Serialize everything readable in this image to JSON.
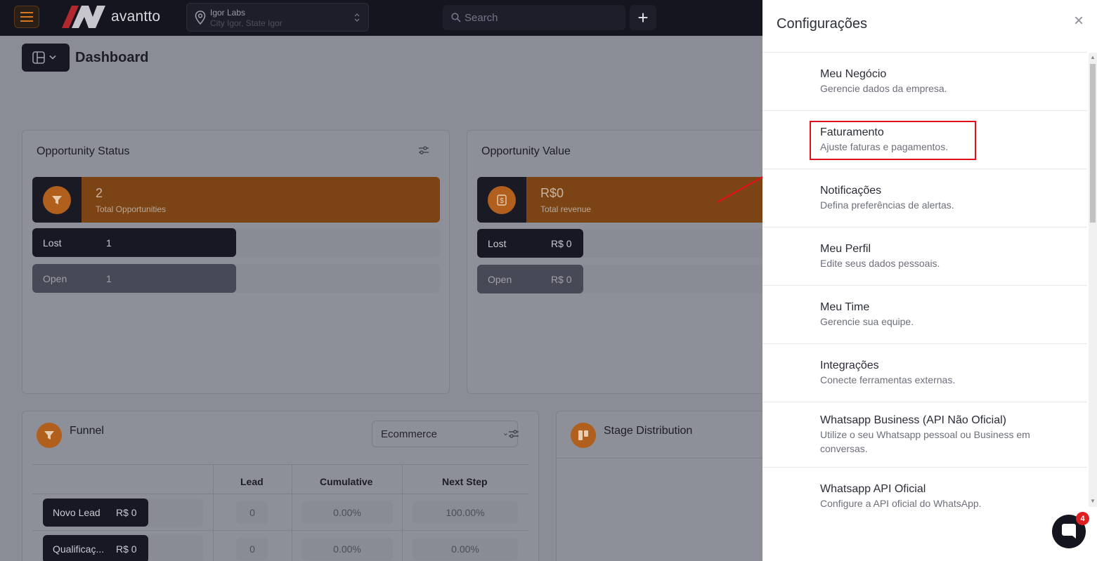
{
  "topbar": {
    "brand": "avantto",
    "location_name": "Igor Labs",
    "location_sub": "City Igor, State Igor",
    "search_placeholder": "Search",
    "add_label": "+"
  },
  "page": {
    "title": "Dashboard"
  },
  "opportunity_status": {
    "title": "Opportunity Status",
    "total_value": "2",
    "total_label": "Total Opportunities",
    "rows": [
      {
        "label": "Lost",
        "value": "1"
      },
      {
        "label": "Open",
        "value": "1"
      }
    ]
  },
  "opportunity_value": {
    "title": "Opportunity Value",
    "total_value": "R$0",
    "total_label": "Total revenue",
    "rows": [
      {
        "label": "Lost",
        "value": "R$ 0"
      },
      {
        "label": "Open",
        "value": "R$ 0"
      }
    ]
  },
  "funnel": {
    "title": "Funnel",
    "pipeline_selected": "Ecommerce",
    "columns": [
      "Lead",
      "Cumulative",
      "Next Step"
    ],
    "rows": [
      {
        "stage": "Novo Lead",
        "amount": "R$ 0",
        "lead": "0",
        "cumulative": "0.00%",
        "next_step": "100.00%"
      },
      {
        "stage": "Qualificaç...",
        "amount": "R$ 0",
        "lead": "0",
        "cumulative": "0.00%",
        "next_step": "0.00%"
      }
    ]
  },
  "stage_distribution": {
    "title": "Stage Distribution"
  },
  "settings_panel": {
    "title": "Configurações",
    "close": "×",
    "items": [
      {
        "title": "Meu Negócio",
        "desc": "Gerencie dados da empresa."
      },
      {
        "title": "Faturamento",
        "desc": "Ajuste faturas e pagamentos."
      },
      {
        "title": "Notificações",
        "desc": "Defina preferências de alertas."
      },
      {
        "title": "Meu Perfil",
        "desc": "Edite seus dados pessoais."
      },
      {
        "title": "Meu Time",
        "desc": "Gerencie sua equipe."
      },
      {
        "title": "Integrações",
        "desc": "Conecte ferramentas externas."
      },
      {
        "title": "Whatsapp Business (API Não Oficial)",
        "desc": "Utilize o seu Whatsapp pessoal ou Business em conversas."
      },
      {
        "title": "Whatsapp API Oficial",
        "desc": "Configure a API oficial do WhatsApp."
      }
    ]
  },
  "chat": {
    "badge": "4"
  },
  "colors": {
    "accent": "#b05f1c",
    "highlight": "#e0101d",
    "dark": "#15151f"
  }
}
